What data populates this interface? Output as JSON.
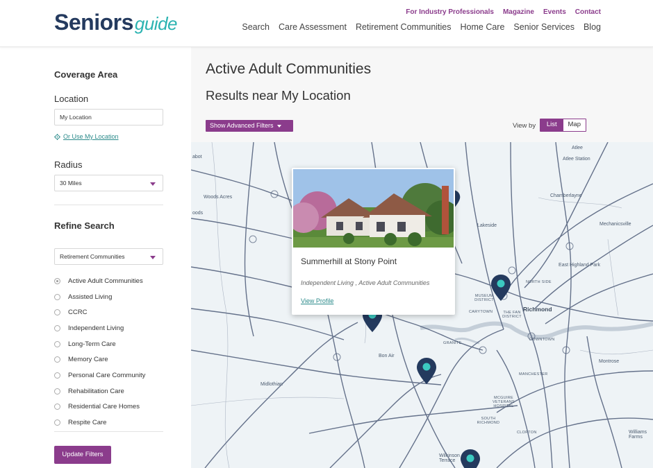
{
  "header": {
    "logo_main": "Seniors",
    "logo_script": "guide",
    "utility_nav": [
      "For Industry Professionals",
      "Magazine",
      "Events",
      "Contact"
    ],
    "main_nav": [
      "Search",
      "Care Assessment",
      "Retirement Communities",
      "Home Care",
      "Senior Services",
      "Blog"
    ]
  },
  "sidebar": {
    "coverage_heading": "Coverage Area",
    "location_label": "Location",
    "location_value": "My Location",
    "use_location_link": "Or Use My Location",
    "radius_label": "Radius",
    "radius_value": "30 Miles",
    "refine_heading": "Refine Search",
    "category_value": "Retirement Communities",
    "options": [
      "Active Adult Communities",
      "Assisted Living",
      "CCRC",
      "Independent Living",
      "Long-Term Care",
      "Memory Care",
      "Personal Care Community",
      "Rehabilitation Care",
      "Residential Care Homes",
      "Respite Care"
    ],
    "selected_option": "Active Adult Communities",
    "update_button": "Update Filters"
  },
  "main": {
    "page_title": "Active Adult Communities",
    "results_title": "Results near My Location",
    "advanced_filters": "Show Advanced Filters",
    "view_by_label": "View by",
    "view_options": [
      "List",
      "Map"
    ],
    "active_view": "List"
  },
  "map": {
    "labels": {
      "atlee": "Atlee",
      "atlee_station": "Atlee Station",
      "woods_acres": "Woods Acres",
      "abot": "abot",
      "oods": "oods",
      "chamberlayne": "Chamberlayne",
      "mechanicsville": "Mechanicsville",
      "lakeside": "Lakeside",
      "east_highland_park": "East Highland Park",
      "north_side": "NORTH SIDE",
      "museum_district": "MUSEUM DISTRICT",
      "the_fan_district": "THE FAN DISTRICT",
      "carytown": "CARYTOWN",
      "richmond": "Richmond",
      "downtown": "DOWNTOWN",
      "granite": "GRANITE",
      "bon_air": "Bon Air",
      "montrose": "Montrose",
      "midlothian": "Midlothian",
      "manchester": "MANCHESTER",
      "mcguire": "MCGUIRE VETERANS HOSPITAL",
      "south_richmond": "SOUTH RICHMOND",
      "clopton": "CLOPTON",
      "wilkinson_terrace": "Wilkinson Terrace",
      "williamsburg_farms": "Williams Farms"
    },
    "popup": {
      "name": "Summerhill at Stony Point",
      "types": "Independent Living , Active Adult Communities",
      "link": "View Profile",
      "close": "×"
    },
    "colors": {
      "pin": "#243a5e",
      "pin_dot": "#3cc9c0",
      "road": "#4d5b78",
      "water": "#c4ced8"
    }
  }
}
